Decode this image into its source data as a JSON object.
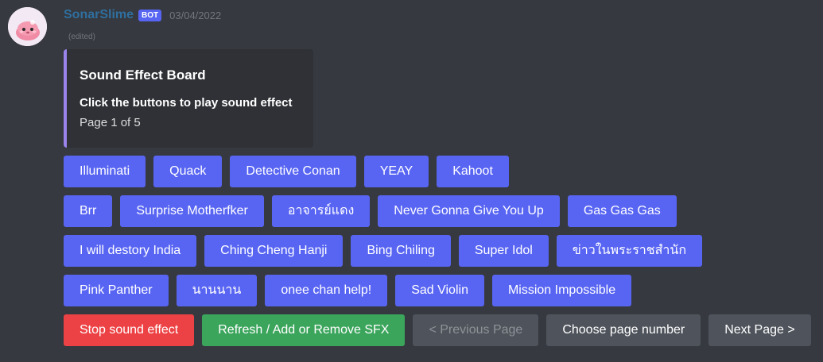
{
  "message": {
    "username": "SonarSlime",
    "bot_tag": "BOT",
    "timestamp": "03/04/2022",
    "edited": "(edited)"
  },
  "embed": {
    "title": "Sound Effect Board",
    "description": "Click the buttons to play sound effect",
    "page": "Page 1 of 5",
    "accent_color": "#9b84ec"
  },
  "rows": [
    [
      "Illuminati",
      "Quack",
      "Detective Conan",
      "YEAY",
      "Kahoot"
    ],
    [
      "Brr",
      "Surprise Motherfker",
      "อาจารย์แดง",
      "Never Gonna Give You Up",
      "Gas Gas Gas"
    ],
    [
      "I will destory India",
      "Ching Cheng Hanji",
      "Bing Chiling",
      "Super Idol",
      "ข่าวในพระราชสำนัก"
    ],
    [
      "Pink Panther",
      "นานนาน",
      "onee chan help!",
      "Sad Violin",
      "Mission Impossible"
    ]
  ],
  "controls": {
    "stop": "Stop sound effect",
    "refresh": "Refresh / Add or Remove SFX",
    "previous": "< Previous Page",
    "choose": "Choose page number",
    "next": "Next Page >"
  },
  "colors": {
    "background": "#36393f",
    "blurple": "#5865f2",
    "danger": "#ed4245",
    "success": "#3ba55c",
    "secondary": "#4f545c"
  }
}
